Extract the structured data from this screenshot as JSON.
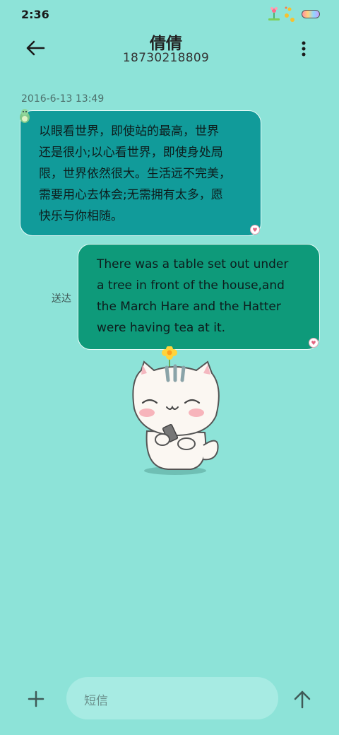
{
  "status_bar": {
    "time": "2:36",
    "battery_colors": [
      "#ff8fa3",
      "#ffd27a",
      "#8fd8ff",
      "#c9a0ff"
    ]
  },
  "header": {
    "contact_name": "倩倩",
    "contact_number": "18730218809",
    "back_icon": "arrow-left-icon",
    "more_icon": "more-vertical-icon"
  },
  "conversation": {
    "timestamp": "2016-6-13 13:49",
    "messages": [
      {
        "direction": "incoming",
        "text": "以眼看世界，即使站的最高，世界还是很小;以心看世界，即使身处局限，世界依然很大。生活远不完美，需要用心去体会;无需拥有太多，愿快乐与你相随。",
        "lines": [
          "以眼看世界，即使站的最高，世界",
          "还是很小;以心看世界，即使身处局",
          "限，世界依然很大。生活远不完美，",
          "需要用心去体会;无需拥有太多，愿",
          "快乐与你相随。"
        ]
      },
      {
        "direction": "outgoing",
        "status": "送达",
        "text": "There was a table set out under a tree in front of the house,and the March Hare and the Hatter were having tea at it.",
        "lines": [
          "There was a table set out under",
          "a tree in front of the house,and",
          "the March Hare and the Hatter",
          "were having tea at it."
        ]
      }
    ]
  },
  "composer": {
    "placeholder": "短信",
    "add_icon": "plus-icon",
    "send_icon": "arrow-up-icon"
  },
  "colors": {
    "background": "#8de3d8",
    "incoming_bubble": "#119b9a",
    "outgoing_bubble": "#0e9a7a",
    "input_background": "#a7ebe3"
  }
}
